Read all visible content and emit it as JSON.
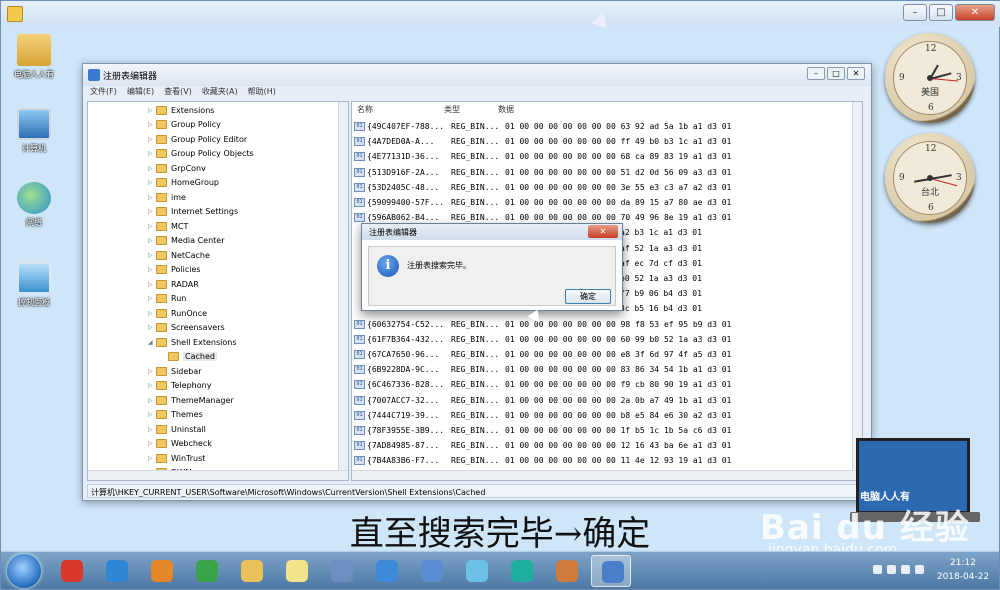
{
  "desktop_icons": [
    {
      "label": "电脑人人有",
      "icon": "user-folder-icon"
    },
    {
      "label": "计算机",
      "icon": "computer-icon"
    },
    {
      "label": "网络",
      "icon": "network-icon"
    },
    {
      "label": "控制面板",
      "icon": "control-panel-icon"
    }
  ],
  "clocks": [
    {
      "city": "美国"
    },
    {
      "city": "台北"
    }
  ],
  "regedit": {
    "title": "注册表编辑器",
    "menu": [
      "文件(F)",
      "编辑(E)",
      "查看(V)",
      "收藏夹(A)",
      "帮助(H)"
    ],
    "tree": [
      {
        "label": "Extensions",
        "depth": 0
      },
      {
        "label": "Group Policy",
        "depth": 0
      },
      {
        "label": "Group Policy Editor",
        "depth": 0
      },
      {
        "label": "Group Policy Objects",
        "depth": 0
      },
      {
        "label": "GrpConv",
        "depth": 0
      },
      {
        "label": "HomeGroup",
        "depth": 0
      },
      {
        "label": "ime",
        "depth": 0
      },
      {
        "label": "Internet Settings",
        "depth": 0
      },
      {
        "label": "MCT",
        "depth": 0
      },
      {
        "label": "Media Center",
        "depth": 0
      },
      {
        "label": "NetCache",
        "depth": 0
      },
      {
        "label": "Policies",
        "depth": 0
      },
      {
        "label": "RADAR",
        "depth": 0
      },
      {
        "label": "Run",
        "depth": 0
      },
      {
        "label": "RunOnce",
        "depth": 0
      },
      {
        "label": "Screensavers",
        "depth": 0
      },
      {
        "label": "Shell Extensions",
        "depth": 0,
        "expanded": true
      },
      {
        "label": "Cached",
        "depth": 1,
        "selected": true
      },
      {
        "label": "Sidebar",
        "depth": 0
      },
      {
        "label": "Telephony",
        "depth": 0
      },
      {
        "label": "ThemeManager",
        "depth": 0
      },
      {
        "label": "Themes",
        "depth": 0
      },
      {
        "label": "Uninstall",
        "depth": 0
      },
      {
        "label": "Webcheck",
        "depth": 0
      },
      {
        "label": "WinTrust",
        "depth": 0
      },
      {
        "label": "DWM",
        "depth": 0
      }
    ],
    "list_headers": {
      "name": "名称",
      "type": "类型",
      "data": "数据"
    },
    "rows": [
      {
        "name": "{49C407EF-788...",
        "type": "REG_BIN...",
        "data": "01 00 00 00 00 00 00 00 63 92 ad 5a 1b a1 d3 01"
      },
      {
        "name": "{4A7DED0A-A...",
        "type": "REG_BIN...",
        "data": "01 00 00 00 00 00 00 00 ff 49 b0 b3 1c a1 d3 01"
      },
      {
        "name": "{4E77131D-36...",
        "type": "REG_BIN...",
        "data": "01 00 00 00 00 00 00 00 68 ca 89 83 19 a1 d3 01"
      },
      {
        "name": "{513D916F-2A...",
        "type": "REG_BIN...",
        "data": "01 00 00 00 00 00 00 00 51 d2 0d 56 09 a3 d3 01"
      },
      {
        "name": "{53D2405C-48...",
        "type": "REG_BIN...",
        "data": "01 00 00 00 00 00 00 00 3e 55 e3 c3 a7 a2 d3 01"
      },
      {
        "name": "{59099400-57F...",
        "type": "REG_BIN...",
        "data": "01 00 00 00 00 00 00 00 da 89 15 a7 80 ae d3 01"
      },
      {
        "name": "{596AB062-B4...",
        "type": "REG_BIN...",
        "data": "01 00 00 00 00 00 00 00 70 49 96 8e 19 a1 d3 01"
      },
      {
        "name": "",
        "type": "",
        "data": "a2 b3 1c a1 d3 01"
      },
      {
        "name": "",
        "type": "",
        "data": "af 52 1a a3 d3 01"
      },
      {
        "name": "",
        "type": "",
        "data": "af ec 7d cf d3 01"
      },
      {
        "name": "",
        "type": "",
        "data": "b0 52 1a a3 d3 01"
      },
      {
        "name": "",
        "type": "",
        "data": "f7 b9 06 b4 d3 01"
      },
      {
        "name": "",
        "type": "",
        "data": "3c b5 16 b4 d3 01"
      },
      {
        "name": "{60632754-C52...",
        "type": "REG_BIN...",
        "data": "01 00 00 00 00 00 00 00 98 f8 53 ef 95 b9 d3 01"
      },
      {
        "name": "{61F7B364-432...",
        "type": "REG_BIN...",
        "data": "01 00 00 00 00 00 00 00 60 99 b0 52 1a a3 d3 01"
      },
      {
        "name": "{67CA7650-96...",
        "type": "REG_BIN...",
        "data": "01 00 00 00 00 00 00 00 e8 3f 6d 97 4f a5 d3 01"
      },
      {
        "name": "{6B9228DA-9C...",
        "type": "REG_BIN...",
        "data": "01 00 00 00 00 00 00 00 83 86 34 54 1b a1 d3 01"
      },
      {
        "name": "{6C467336-828...",
        "type": "REG_BIN...",
        "data": "01 00 00 00 00 00 00 00 f9 cb 80 90 19 a1 d3 01"
      },
      {
        "name": "{7007ACC7-32...",
        "type": "REG_BIN...",
        "data": "01 00 00 00 00 00 00 00 2a 0b a7 49 1b a1 d3 01"
      },
      {
        "name": "{7444C719-39...",
        "type": "REG_BIN...",
        "data": "01 00 00 00 00 00 00 00 b8 e5 84 e6 30 a2 d3 01"
      },
      {
        "name": "{78F3955E-3B9...",
        "type": "REG_BIN...",
        "data": "01 00 00 00 00 00 00 00 1f b5 1c 1b 5a c6 d3 01"
      },
      {
        "name": "{7AD84985-87...",
        "type": "REG_BIN...",
        "data": "01 00 00 00 00 00 00 00 12 16 43 ba 6e a1 d3 01"
      },
      {
        "name": "{7B4A83B6-F7...",
        "type": "REG_BIN...",
        "data": "01 00 00 00 00 00 00 00 11 4e 12 93 19 a1 d3 01"
      }
    ],
    "statusbar": "计算机\\HKEY_CURRENT_USER\\Software\\Microsoft\\Windows\\CurrentVersion\\Shell Extensions\\Cached"
  },
  "dialog": {
    "title": "注册表编辑器",
    "message": "注册表搜索完毕。",
    "ok_label": "确定",
    "close_label": "✕"
  },
  "caption": "直至搜索完毕→确定",
  "logo": {
    "text": "电脑人人有"
  },
  "watermark": {
    "brand": "Bai du 经验",
    "url": "jingyan.baidu.com"
  },
  "taskbar": {
    "time": "21:12",
    "date": "2018-04-22",
    "apps": [
      {
        "icon": "jiang-app-icon",
        "color": "#d9382b"
      },
      {
        "icon": "ie-icon",
        "color": "#2f86d6"
      },
      {
        "icon": "media-player-icon",
        "color": "#e6862b"
      },
      {
        "icon": "chrome-icon",
        "color": "#3aa34a"
      },
      {
        "icon": "file-explorer-icon",
        "color": "#e8c15a"
      },
      {
        "icon": "sticky-notes-icon",
        "color": "#f1e48a"
      },
      {
        "icon": "document-icon",
        "color": "#6b8fc0"
      },
      {
        "icon": "browser-360-icon",
        "color": "#3d8bd8"
      },
      {
        "icon": "remote-desktop-icon",
        "color": "#5a8ed0"
      },
      {
        "icon": "pinwheel-icon",
        "color": "#6bc0e8"
      },
      {
        "icon": "headset-icon",
        "color": "#1faf9f"
      },
      {
        "icon": "paint-icon",
        "color": "#d07a3b"
      },
      {
        "icon": "regedit-icon",
        "color": "#4a7ec9"
      }
    ]
  }
}
